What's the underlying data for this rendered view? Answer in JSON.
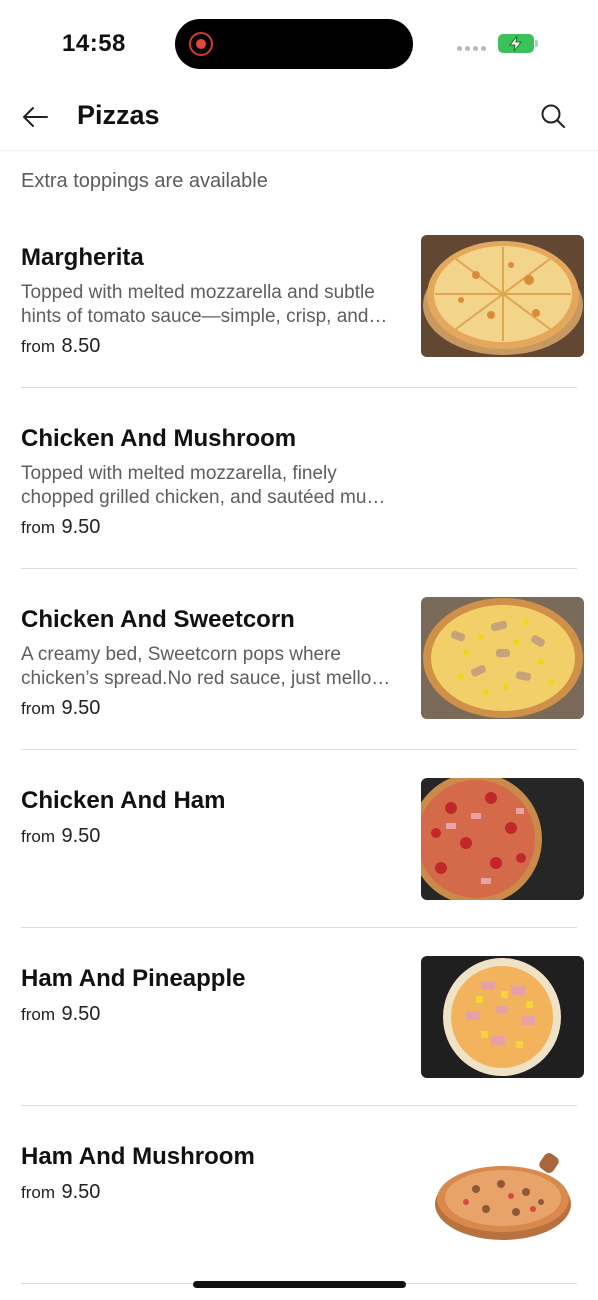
{
  "status_bar": {
    "time": "14:58"
  },
  "header": {
    "title": "Pizzas",
    "back_icon": "arrow-left-icon",
    "search_icon": "search-icon"
  },
  "subtitle": "Extra toppings are available",
  "items": [
    {
      "name": "Margherita",
      "desc_line1": "Topped with melted mozzarella and subtle",
      "desc_line2": "hints of tomato sauce—simple, crisp, and…",
      "from_label": "from",
      "price": "8.50"
    },
    {
      "name": "Chicken And Mushroom",
      "desc_line1": "Topped with melted mozzarella, finely",
      "desc_line2": "chopped grilled chicken, and sautéed mu…",
      "from_label": "from",
      "price": "9.50"
    },
    {
      "name": "Chicken And Sweetcorn",
      "desc_line1": "A creamy bed, Sweetcorn pops where",
      "desc_line2": "chicken’s spread.No red sauce, just mello…",
      "from_label": "from",
      "price": "9.50"
    },
    {
      "name": "Chicken And Ham",
      "from_label": "from",
      "price": "9.50"
    },
    {
      "name": "Ham And Pineapple",
      "from_label": "from",
      "price": "9.50"
    },
    {
      "name": "Ham And Mushroom",
      "from_label": "from",
      "price": "9.50"
    }
  ],
  "colors": {
    "background": "#ffffff",
    "text_primary": "#111111",
    "text_secondary": "#5e5e5e",
    "divider": "#dcdcdc",
    "recording": "#e8443a",
    "battery": "#3cc15a"
  }
}
